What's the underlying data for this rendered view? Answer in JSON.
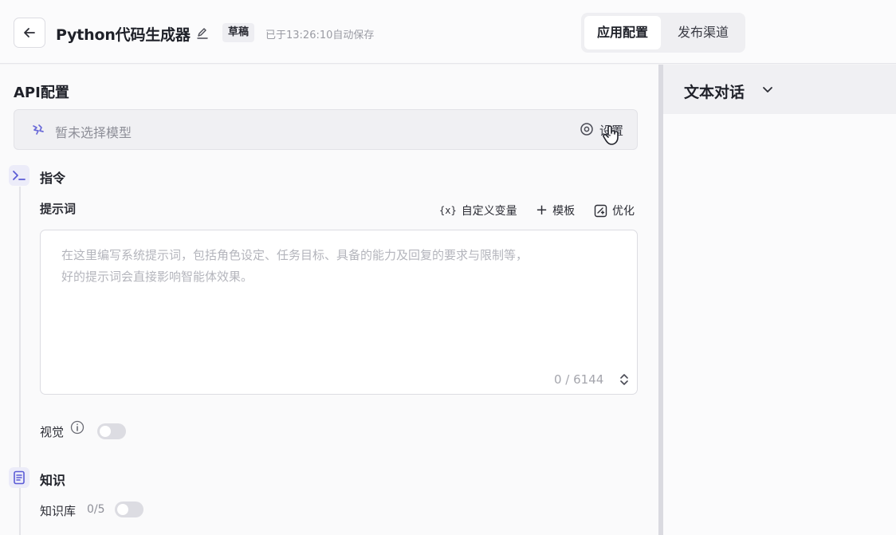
{
  "header": {
    "app_title": "Python代码生成器",
    "draft_badge": "草稿",
    "autosave_text": "已于13:26:10自动保存",
    "tabs": [
      {
        "label": "应用配置",
        "active": true
      },
      {
        "label": "发布渠道",
        "active": false
      }
    ]
  },
  "api_config": {
    "title": "API配置",
    "model_placeholder": "暂未选择模型",
    "settings_label": "设置"
  },
  "instruction": {
    "section_label": "指令",
    "prompt_label": "提示词",
    "tools": {
      "custom_var": "自定义变量",
      "template": "模板",
      "optimize": "优化"
    },
    "placeholder_line1": "在这里编写系统提示词，包括角色设定、任务目标、具备的能力及回复的要求与限制等，",
    "placeholder_line2": "好的提示词会直接影响智能体效果。",
    "char_count": "0 / 6144",
    "vision_label": "视觉",
    "vision_enabled": false
  },
  "knowledge": {
    "section_label": "知识",
    "kb_label": "知识库",
    "kb_count": "0/5",
    "kb_enabled": false
  },
  "right_panel": {
    "dialog_title": "文本对话"
  },
  "colors": {
    "accent": "#5b5bd6",
    "toggle_off": "#dcdce2"
  }
}
